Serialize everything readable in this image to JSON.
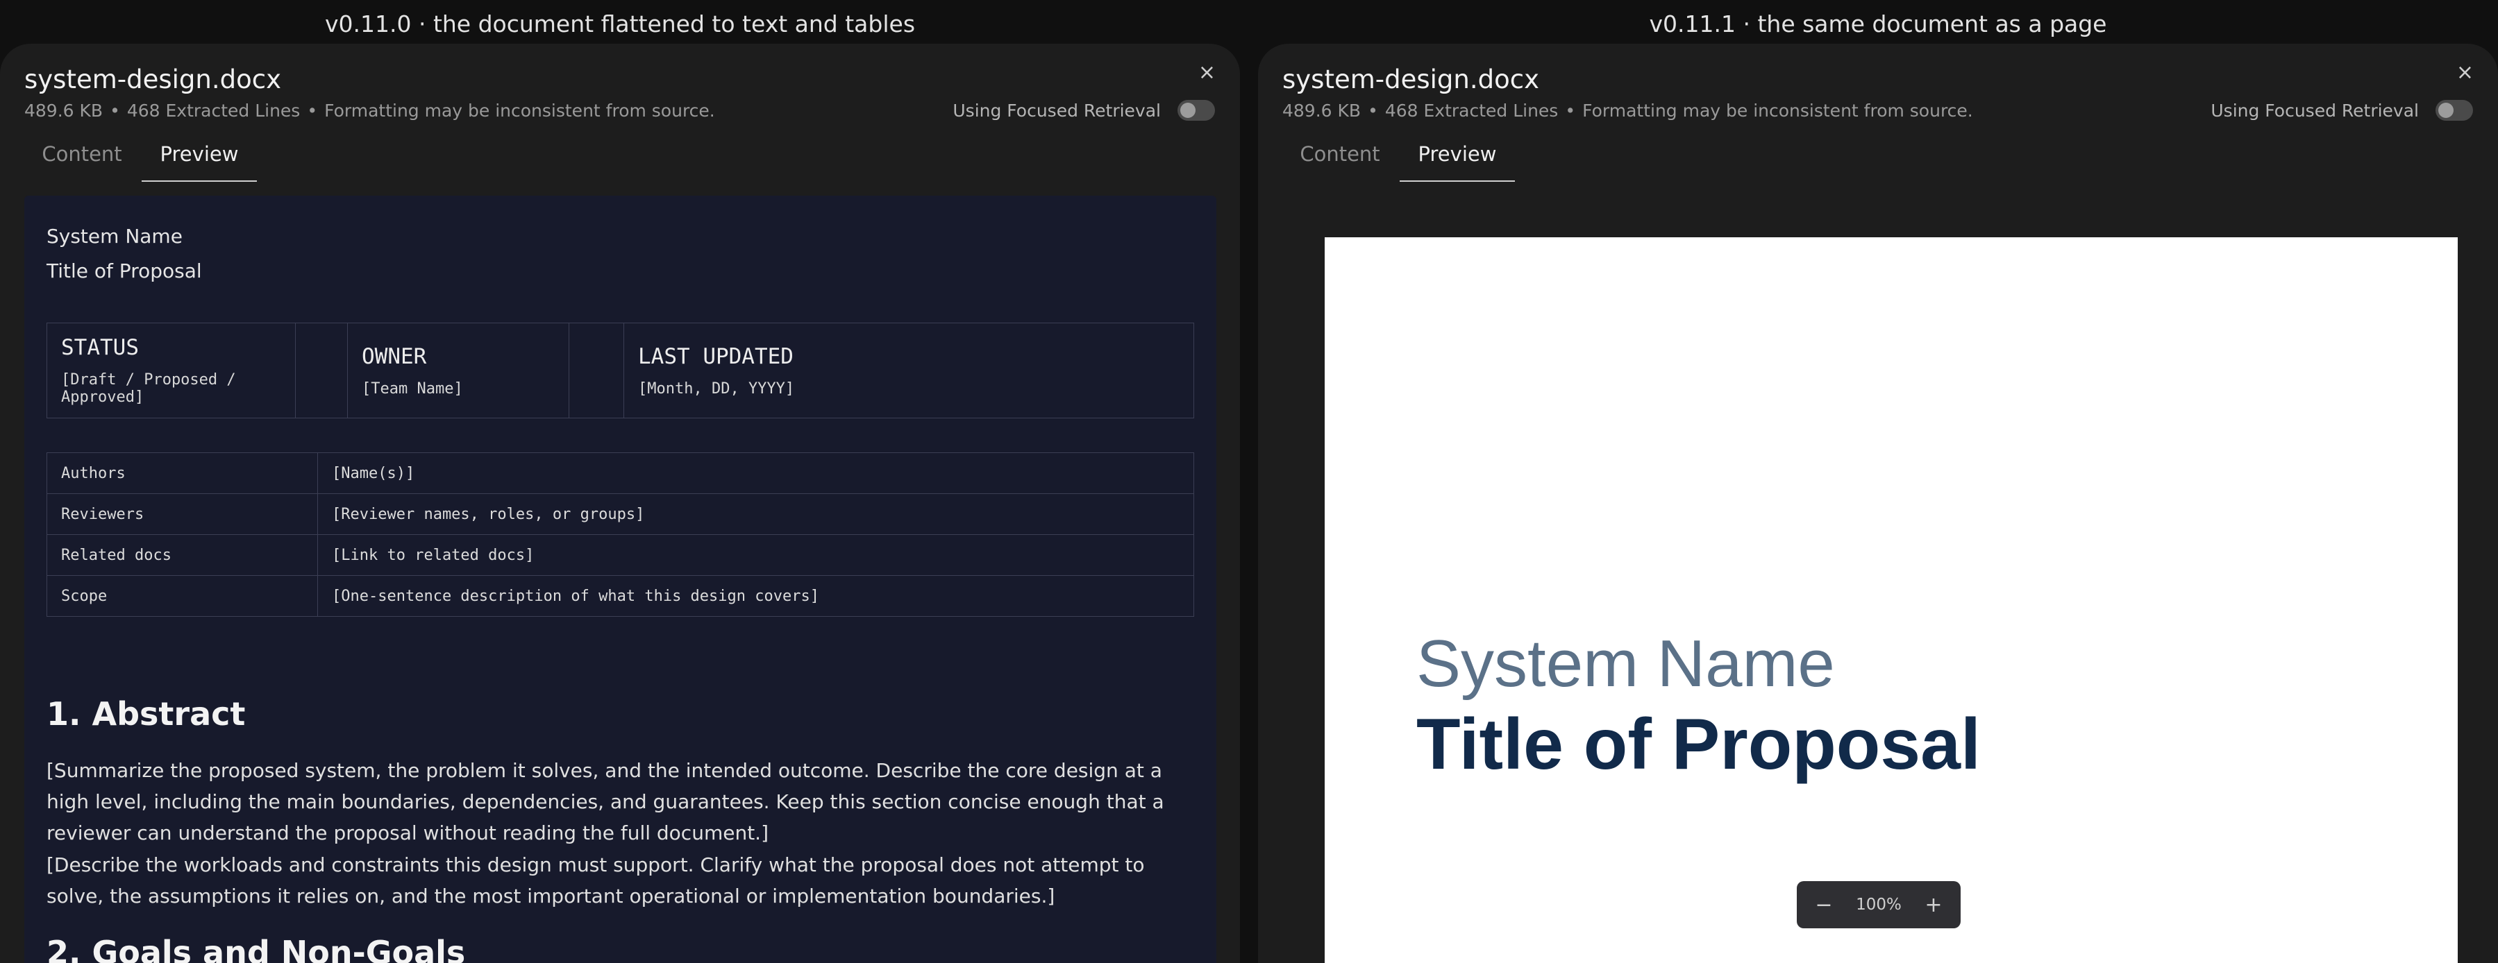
{
  "captions": {
    "left": "v0.11.0 · the document flattened to text and tables",
    "right": "v0.11.1 · the same document as a page"
  },
  "file": {
    "name": "system-design.docx",
    "size": "489.6 KB",
    "lines": "468 Extracted Lines",
    "note": "Formatting may be inconsistent from source.",
    "separator": "•"
  },
  "focused_retrieval": {
    "label": "Using Focused Retrieval",
    "enabled": false
  },
  "close_icon": "×",
  "tabs": [
    {
      "label": "Content",
      "active": false
    },
    {
      "label": "Preview",
      "active": true
    }
  ],
  "flattened": {
    "system_name": "System Name",
    "title": "Title of Proposal",
    "status_table": [
      {
        "heading": "STATUS",
        "value": "[Draft / Proposed / Approved]"
      },
      {
        "heading": "OWNER",
        "value": "[Team Name]"
      },
      {
        "heading": "LAST UPDATED",
        "value": "[Month, DD, YYYY]"
      }
    ],
    "info_table": [
      {
        "key": "Authors",
        "value": "[Name(s)]"
      },
      {
        "key": "Reviewers",
        "value": "[Reviewer names, roles, or groups]"
      },
      {
        "key": "Related docs",
        "value": "[Link to related docs]"
      },
      {
        "key": "Scope",
        "value": "[One-sentence description of what this design covers]"
      }
    ],
    "section1_heading": "1. Abstract",
    "para1": "[Summarize the proposed system, the problem it solves, and the intended outcome. Describe the core design at a high level, including the main boundaries, dependencies, and guarantees. Keep this section concise enough that a reviewer can understand the proposal without reading the full document.]",
    "para2": "[Describe the workloads and constraints this design must support. Clarify what the proposal does not attempt to solve, the assumptions it relies on, and the most important operational or implementation boundaries.]",
    "section2_heading": "2. Goals and Non-Goals"
  },
  "page_view": {
    "system_name": "System Name",
    "title": "Title of Proposal",
    "zoom": "100%",
    "zoom_out_icon": "−",
    "zoom_in_icon": "+"
  }
}
